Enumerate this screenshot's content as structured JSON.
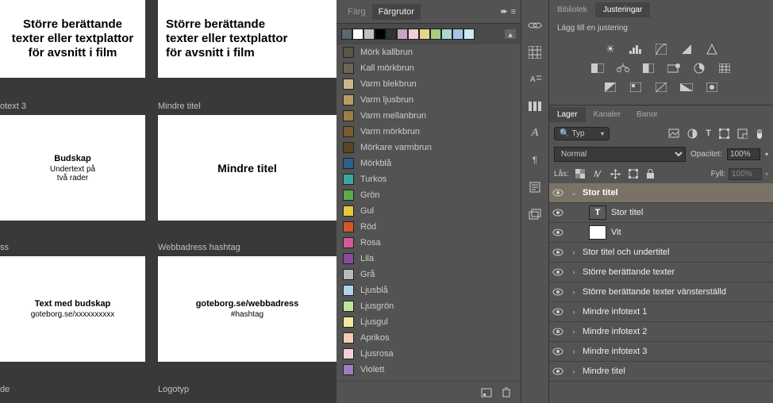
{
  "canvas": {
    "artboards": {
      "ab1_title": "Större berättande\ntexter eller textplattor\nför avsnitt i film",
      "ab2_title": "Större berättande\ntexter eller textplattor\nför avsnitt i film",
      "ab3_label": "otext 3",
      "ab4_label": "Mindre titel",
      "ab3_heading": "Budskap",
      "ab3_sub": "Undertext på\ntvå rader",
      "ab4_heading": "Mindre titel",
      "ab5_label": "ss",
      "ab6_label": "Webbadress hashtag",
      "ab5_heading": "Text med budskap",
      "ab5_url": "goteborg.se/xxxxxxxxxx",
      "ab6_heading": "goteborg.se/webbadress",
      "ab6_sub": "#hashtag",
      "ab7_label": "de",
      "ab8_label": "Logotyp"
    }
  },
  "swatches": {
    "tab_color": "Färg",
    "tab_swatches": "Färgrutor",
    "chips": [
      "#5a6670",
      "#ffffff",
      "#c0c0c0",
      "#000000",
      "#323232",
      "#c9a3c6",
      "#f4d0d5",
      "#e5d68c",
      "#a7cd7c",
      "#a9d8d3",
      "#a6c5e3",
      "#cce8f4"
    ],
    "items": [
      {
        "name": "Mörk kallbrun",
        "hex": "#5a5546"
      },
      {
        "name": "Kall mörkbrun",
        "hex": "#6d6453"
      },
      {
        "name": "Varm blekbrun",
        "hex": "#c9b988"
      },
      {
        "name": "Varm ljusbrun",
        "hex": "#b89e63"
      },
      {
        "name": "Varm mellanbrun",
        "hex": "#9c7e46"
      },
      {
        "name": "Varm mörkbrun",
        "hex": "#7a5c2e"
      },
      {
        "name": "Mörkare varmbrun",
        "hex": "#5e4520"
      },
      {
        "name": "Mörkblå",
        "hex": "#2f5e8c"
      },
      {
        "name": "Turkos",
        "hex": "#3aa6a0"
      },
      {
        "name": "Grön",
        "hex": "#5aab4a"
      },
      {
        "name": "Gul",
        "hex": "#e7c637"
      },
      {
        "name": "Röd",
        "hex": "#d1572b"
      },
      {
        "name": "Rosa",
        "hex": "#d45a9a"
      },
      {
        "name": "Lila",
        "hex": "#8c4a9e"
      },
      {
        "name": "Grå",
        "hex": "#b8b8b8"
      },
      {
        "name": "Ljusblå",
        "hex": "#aed2ea"
      },
      {
        "name": "Ljusgrön",
        "hex": "#bfe29e"
      },
      {
        "name": "Ljusgul",
        "hex": "#f3e6a0"
      },
      {
        "name": "Aprikos",
        "hex": "#f4cbb1"
      },
      {
        "name": "Ljusrosa",
        "hex": "#f4cfd9"
      },
      {
        "name": "Violett",
        "hex": "#a07cc2"
      }
    ]
  },
  "adjustments": {
    "tab_library": "Bibliotek",
    "tab_adjust": "Justeringar",
    "add_label": "Lägg till en justering"
  },
  "layers": {
    "tab_layers": "Lager",
    "tab_channels": "Kanaler",
    "tab_paths": "Banor",
    "search_kind": "Typ",
    "blend_mode": "Normal",
    "opacity_label": "Opacitet:",
    "opacity_value": "100%",
    "lock_label": "Lås:",
    "fill_label": "Fyll:",
    "fill_value": "100%",
    "items": [
      {
        "name": "Stor titel",
        "selected": true,
        "expanded": true
      },
      {
        "name": "Stor titel",
        "thumb": "T",
        "child": true
      },
      {
        "name": "Vit",
        "thumb": "white",
        "child": true
      },
      {
        "name": "Stor titel och undertitel"
      },
      {
        "name": "Större berättande texter"
      },
      {
        "name": "Större berättande texter vänsterställd"
      },
      {
        "name": "Mindre infotext 1"
      },
      {
        "name": "Mindre infotext 2"
      },
      {
        "name": "Mindre infotext 3"
      },
      {
        "name": "Mindre titel"
      }
    ]
  }
}
